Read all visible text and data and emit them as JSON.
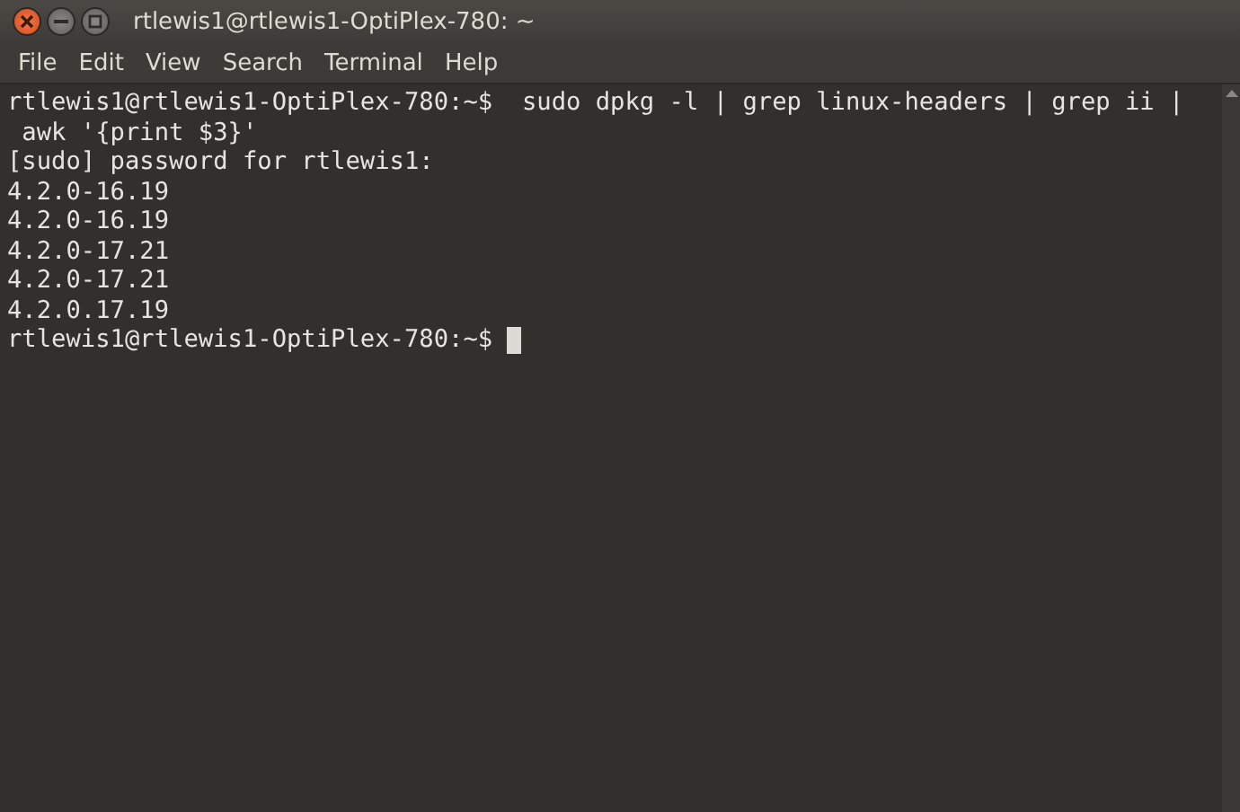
{
  "window": {
    "title": "rtlewis1@rtlewis1-OptiPlex-780: ~"
  },
  "menu": [
    "File",
    "Edit",
    "View",
    "Search",
    "Terminal",
    "Help"
  ],
  "terminal": {
    "lines": [
      "rtlewis1@rtlewis1-OptiPlex-780:~$  sudo dpkg -l | grep linux-headers | grep ii |",
      " awk '{print $3}'",
      "[sudo] password for rtlewis1:",
      "4.2.0-16.19",
      "4.2.0-16.19",
      "4.2.0-17.21",
      "4.2.0-17.21",
      "4.2.0.17.19"
    ],
    "prompt": "rtlewis1@rtlewis1-OptiPlex-780:~$ "
  }
}
